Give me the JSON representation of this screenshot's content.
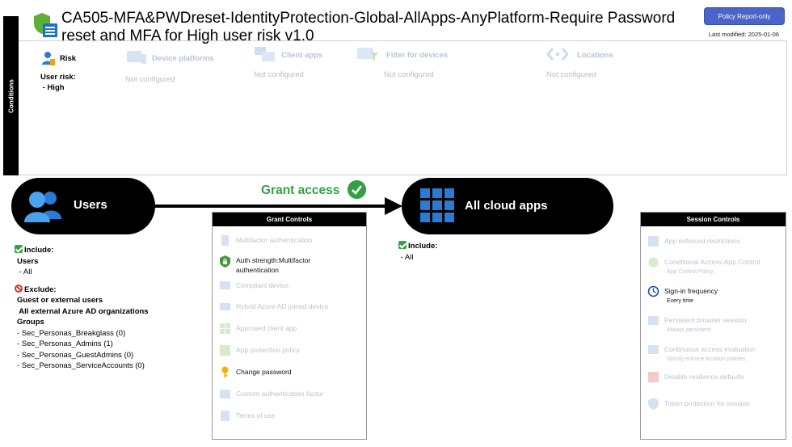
{
  "policy": {
    "title": "CA505-MFA&PWDreset-IdentityProtection-Global-AllApps-AnyPlatform-Require Password reset and MFA for High user risk v1.0",
    "report_button": "Policy Report-only",
    "last_modified": "Last modified: 2025-01-06"
  },
  "conditions": {
    "tab_label": "Conditions",
    "risk": {
      "label": "Risk",
      "line1": "User risk:",
      "line2": " - High"
    },
    "items": [
      {
        "name": "Device platforms",
        "status": "Not configured"
      },
      {
        "name": "Client apps",
        "status": "Not configured"
      },
      {
        "name": "Filter for devices",
        "status": "Not configured"
      },
      {
        "name": "Locations",
        "status": "Not configured"
      }
    ]
  },
  "flow": {
    "users_label": "Users",
    "apps_label": "All cloud apps",
    "grant_label": "Grant access"
  },
  "users": {
    "include_label": "Include:",
    "include_lines": [
      "Users",
      " - All"
    ],
    "exclude_label": "Exclude:",
    "exclude_lines": [
      "Guest or external users",
      " All external Azure AD organizations",
      "Groups"
    ],
    "groups": [
      "- Sec_Personas_Breakglass (0)",
      "- Sec_Personas_Admins (1)",
      "- Sec_Personas_GuestAdmins (0)",
      "- Sec_Personas_ServiceAccounts (0)"
    ]
  },
  "apps": {
    "include_label": "Include:",
    "include_value": " - All"
  },
  "grant_controls": {
    "header": "Grant Controls",
    "items": [
      {
        "label": "Multifactor authentication",
        "active": false
      },
      {
        "label": "Auth strength:Multifactor authentication",
        "active": true
      },
      {
        "label": "Compliant device",
        "active": false
      },
      {
        "label": "Hybrid Azure AD joined device",
        "active": false
      },
      {
        "label": "Approved client app",
        "active": false
      },
      {
        "label": "App protection policy",
        "active": false
      },
      {
        "label": "Change password",
        "active": true
      },
      {
        "label": "Custom authentication factor",
        "active": false
      },
      {
        "label": "Terms of use",
        "active": false
      }
    ]
  },
  "session_controls": {
    "header": "Session Controls",
    "items": [
      {
        "label": "App enforced restrictions",
        "sub": "",
        "active": false
      },
      {
        "label": "Conditional Access App Control",
        "sub": "App Control Policy",
        "active": false
      },
      {
        "label": "Sign-in frequency",
        "sub": "Every time",
        "active": true
      },
      {
        "label": "Persistent browser session",
        "sub": "Always persistent",
        "active": false
      },
      {
        "label": "Continuous access evaluation",
        "sub": "Strictly enforce location policies",
        "active": false
      },
      {
        "label": "Disable resilience defaults",
        "sub": "",
        "active": false
      },
      {
        "label": "Token protection for session",
        "sub": "",
        "active": false
      }
    ]
  },
  "colors": {
    "accent_green": "#33a048",
    "button_blue": "#4a64c8",
    "disabled_text": "#bcc3cc"
  }
}
